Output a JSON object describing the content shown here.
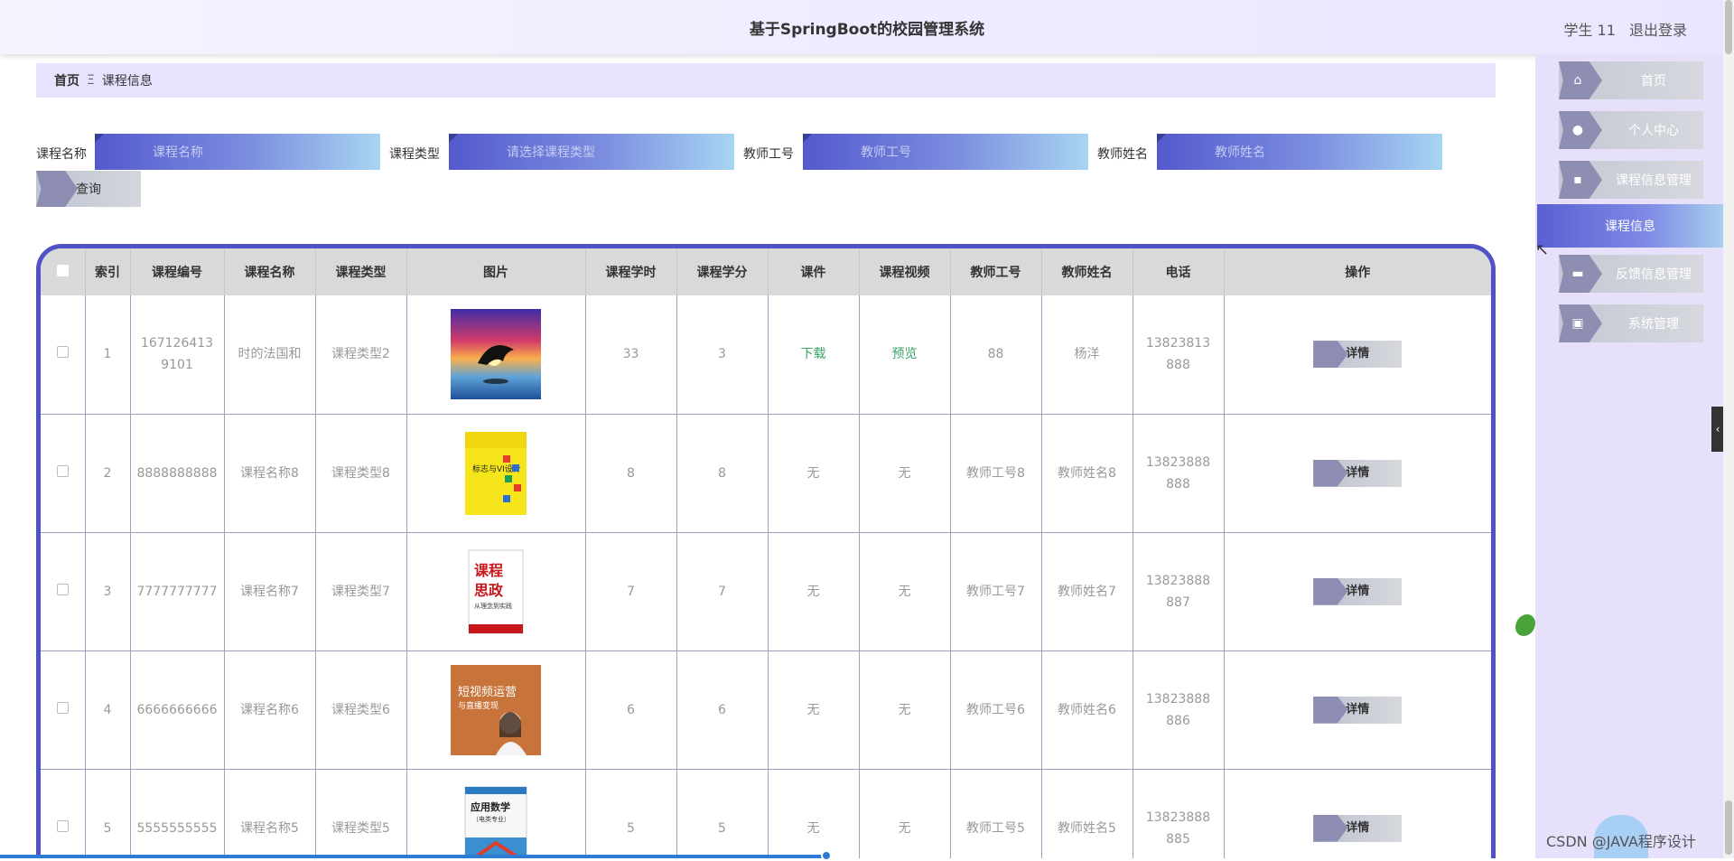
{
  "header": {
    "title": "基于SpringBoot的校园管理系统",
    "user": "学生 11",
    "logout": "退出登录"
  },
  "breadcrumb": {
    "home": "首页",
    "separator": "Ξ",
    "current": "课程信息"
  },
  "filters": {
    "course_name_label": "课程名称",
    "course_name_placeholder": "课程名称",
    "course_type_label": "课程类型",
    "course_type_placeholder": "请选择课程类型",
    "teacher_no_label": "教师工号",
    "teacher_no_placeholder": "教师工号",
    "teacher_name_label": "教师姓名",
    "teacher_name_placeholder": "教师姓名",
    "query_label": "查询"
  },
  "sidebar": {
    "items": [
      {
        "label": "首页",
        "icon": "home-icon"
      },
      {
        "label": "个人中心",
        "icon": "user-icon"
      },
      {
        "label": "课程信息管理",
        "icon": "chat-icon"
      },
      {
        "label": "反馈信息管理",
        "icon": "briefcase-icon"
      },
      {
        "label": "系统管理",
        "icon": "clipboard-icon"
      }
    ],
    "active": "课程信息"
  },
  "table": {
    "headers": [
      "索引",
      "课程编号",
      "课程名称",
      "课程类型",
      "图片",
      "课程学时",
      "课程学分",
      "课件",
      "课程视频",
      "教师工号",
      "教师姓名",
      "电话",
      "操作"
    ],
    "rows": [
      {
        "index": "1",
        "code": "1671264139101",
        "name": "时的法国和",
        "type": "课程类型2",
        "hours": "33",
        "credits": "3",
        "courseware": "下载",
        "video": "预览",
        "teacher_no": "88",
        "teacher_name": "杨洋",
        "phone": "13823813888",
        "action": "详情",
        "image": "dolphin-sunset"
      },
      {
        "index": "2",
        "code": "8888888888",
        "name": "课程名称8",
        "type": "课程类型8",
        "hours": "8",
        "credits": "8",
        "courseware": "无",
        "video": "无",
        "teacher_no": "教师工号8",
        "teacher_name": "教师姓名8",
        "phone": "13823888888",
        "action": "详情",
        "image": "book-yellow"
      },
      {
        "index": "3",
        "code": "7777777777",
        "name": "课程名称7",
        "type": "课程类型7",
        "hours": "7",
        "credits": "7",
        "courseware": "无",
        "video": "无",
        "teacher_no": "教师工号7",
        "teacher_name": "教师姓名7",
        "phone": "13823888887",
        "action": "详情",
        "image": "book-red"
      },
      {
        "index": "4",
        "code": "6666666666",
        "name": "课程名称6",
        "type": "课程类型6",
        "hours": "6",
        "credits": "6",
        "courseware": "无",
        "video": "无",
        "teacher_no": "教师工号6",
        "teacher_name": "教师姓名6",
        "phone": "13823888886",
        "action": "详情",
        "image": "book-orange"
      },
      {
        "index": "5",
        "code": "5555555555",
        "name": "课程名称5",
        "type": "课程类型5",
        "hours": "5",
        "credits": "5",
        "courseware": "无",
        "video": "无",
        "teacher_no": "教师工号5",
        "teacher_name": "教师姓名5",
        "phone": "13823888885",
        "action": "详情",
        "image": "book-math"
      }
    ]
  },
  "book_texts": {
    "book2": "标志与VI设计",
    "book3_a": "课程",
    "book3_b": "思政",
    "book3_c": "从理念到实践",
    "book4_a": "短视频运营",
    "book4_b": "与直播变现",
    "book5_a": "应用数学",
    "book5_b": "（电类专业）"
  },
  "watermark": "CSDN @JAVA程序设计"
}
